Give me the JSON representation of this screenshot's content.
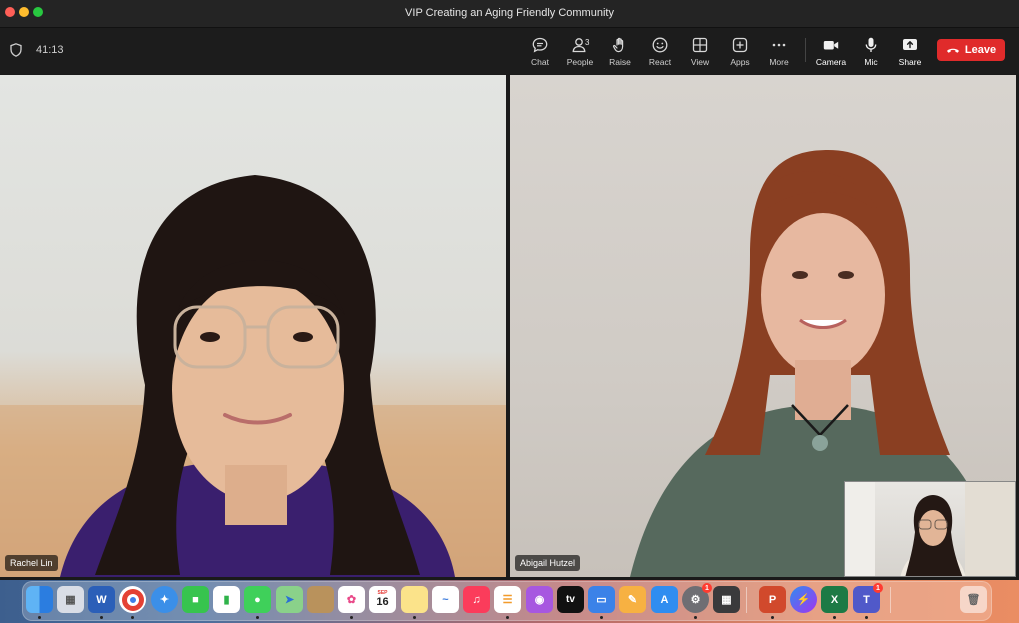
{
  "window": {
    "title": "VIP Creating an Aging Friendly Community"
  },
  "toolbar": {
    "timer": "41:13",
    "buttons": [
      {
        "label": "Chat",
        "icon": "chat-icon"
      },
      {
        "label": "People",
        "icon": "people-icon",
        "count": "3"
      },
      {
        "label": "Raise",
        "icon": "hand-icon"
      },
      {
        "label": "React",
        "icon": "smile-icon"
      },
      {
        "label": "View",
        "icon": "grid-icon"
      },
      {
        "label": "Apps",
        "icon": "plus-square-icon"
      },
      {
        "label": "More",
        "icon": "ellipsis-icon"
      },
      {
        "label": "Camera",
        "icon": "camera-icon"
      },
      {
        "label": "Mic",
        "icon": "mic-icon"
      },
      {
        "label": "Share",
        "icon": "share-icon"
      }
    ],
    "leave_label": "Leave",
    "leave_color": "#e02b2b"
  },
  "participants": [
    {
      "name": "Rachel Lin"
    },
    {
      "name": "Abigail Hutzel"
    }
  ],
  "dock": {
    "calendar_day": "16",
    "calendar_month": "SEP",
    "tv_label": "tv",
    "badges": {
      "system_settings": "1",
      "teams": "1"
    },
    "apps": [
      "finder-icon",
      "launchpad-icon",
      "word-icon",
      "chrome-icon",
      "safari-icon",
      "facetime-icon",
      "numbers-icon",
      "messages-icon",
      "maps-icon",
      "contacts-icon",
      "photos-icon",
      "calendar-icon",
      "notes-icon",
      "freeform-icon",
      "music-icon",
      "reminders-icon",
      "podcasts-icon",
      "tv-icon",
      "keynote-icon",
      "pages-icon",
      "app-store-icon",
      "system-settings-icon",
      "calculator-icon",
      "powerpoint-icon",
      "messenger-icon",
      "excel-icon",
      "teams-icon",
      "trash-icon"
    ]
  }
}
